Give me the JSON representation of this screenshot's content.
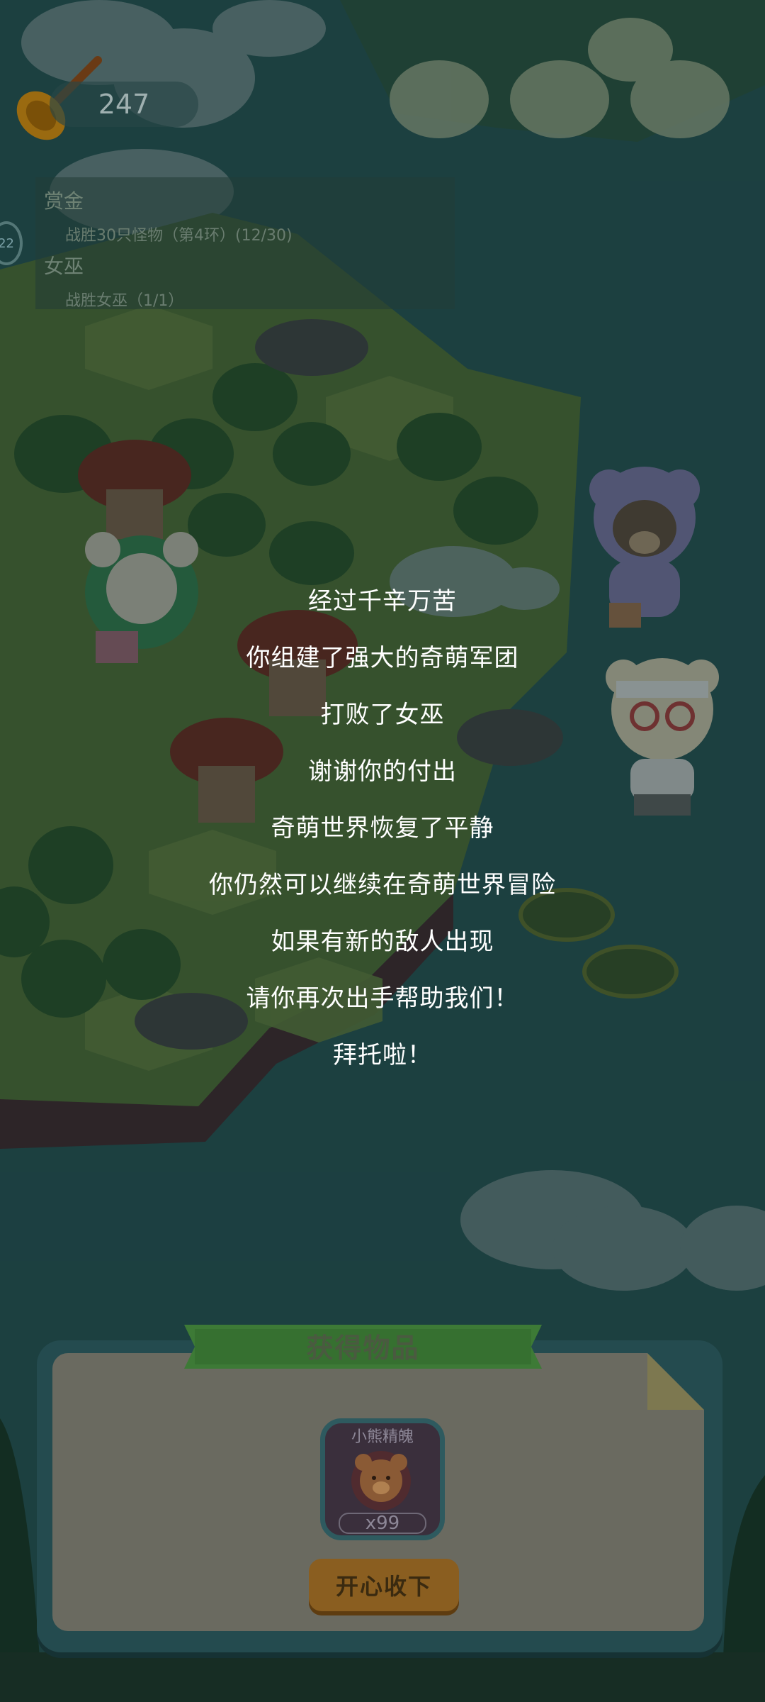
{
  "hud": {
    "currency_value": "247",
    "icons": {
      "currency": "honey-dipper-icon",
      "side": "compass-badge-icon"
    },
    "side_badge_text": "22"
  },
  "quests": [
    {
      "title": "赏金",
      "desc": "战胜30只怪物（第4环）(12/30)"
    },
    {
      "title": "女巫",
      "desc": "战胜女巫（1/1）"
    }
  ],
  "story_lines": [
    "经过千辛万苦",
    "你组建了强大的奇萌军团",
    "打败了女巫",
    "谢谢你的付出",
    "奇萌世界恢复了平静",
    "你仍然可以继续在奇萌世界冒险",
    "如果有新的敌人出现",
    "请你再次出手帮助我们！",
    "拜托啦！"
  ],
  "reward_dialog": {
    "title": "获得物品",
    "item": {
      "name": "小熊精魄",
      "count": "x99",
      "icon": "bear-spirit-icon"
    },
    "accept_label": "开心收下"
  },
  "colors": {
    "water": "#1f4a4b",
    "overlay": "#0a1e20",
    "dialog_frame": "#244b4f",
    "ribbon": "#3d7a36",
    "button": "#8a5e20"
  }
}
